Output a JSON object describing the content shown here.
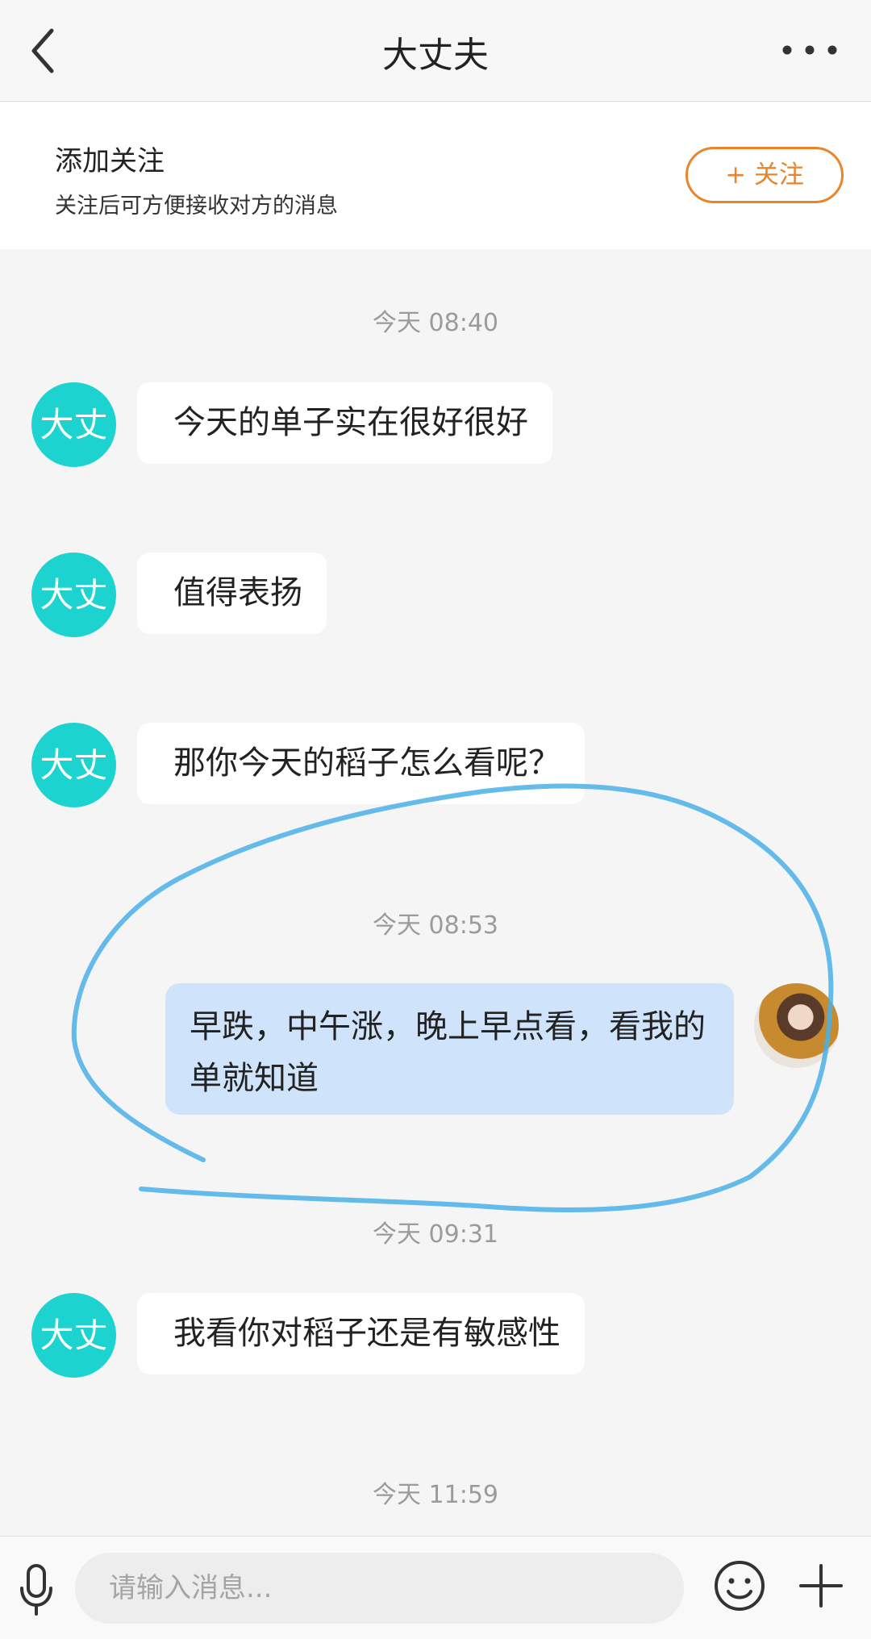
{
  "header": {
    "title": "大丈夫",
    "back_icon": "chevron-left-icon",
    "more_icon": "more-horizontal-icon"
  },
  "follow_bar": {
    "title": "添加关注",
    "subtitle": "关注后可方便接收对方的消息",
    "button_label": "+ 关注",
    "accent_color": "#e8852b"
  },
  "contact": {
    "avatar_text": "大丈",
    "avatar_color": "#1dd3cf"
  },
  "messages": {
    "t1": "今天 08:40",
    "m1": "今天的单子实在很好很好",
    "m2": "值得表扬",
    "m3": "那你今天的稻子怎么看呢？",
    "t2": "今天 08:53",
    "m4": "早跌，中午涨，晚上早点看，看我的单就知道",
    "t3": "今天 09:31",
    "m5": "我看你对稻子还是有敏感性",
    "t4": "今天 11:59"
  },
  "input_bar": {
    "placeholder": "请输入消息...",
    "mic_icon": "microphone-icon",
    "emoji_icon": "smiley-icon",
    "plus_icon": "plus-icon"
  },
  "colors": {
    "outgoing_bubble": "#cfe4fa",
    "scribble": "#4ab0e6"
  }
}
